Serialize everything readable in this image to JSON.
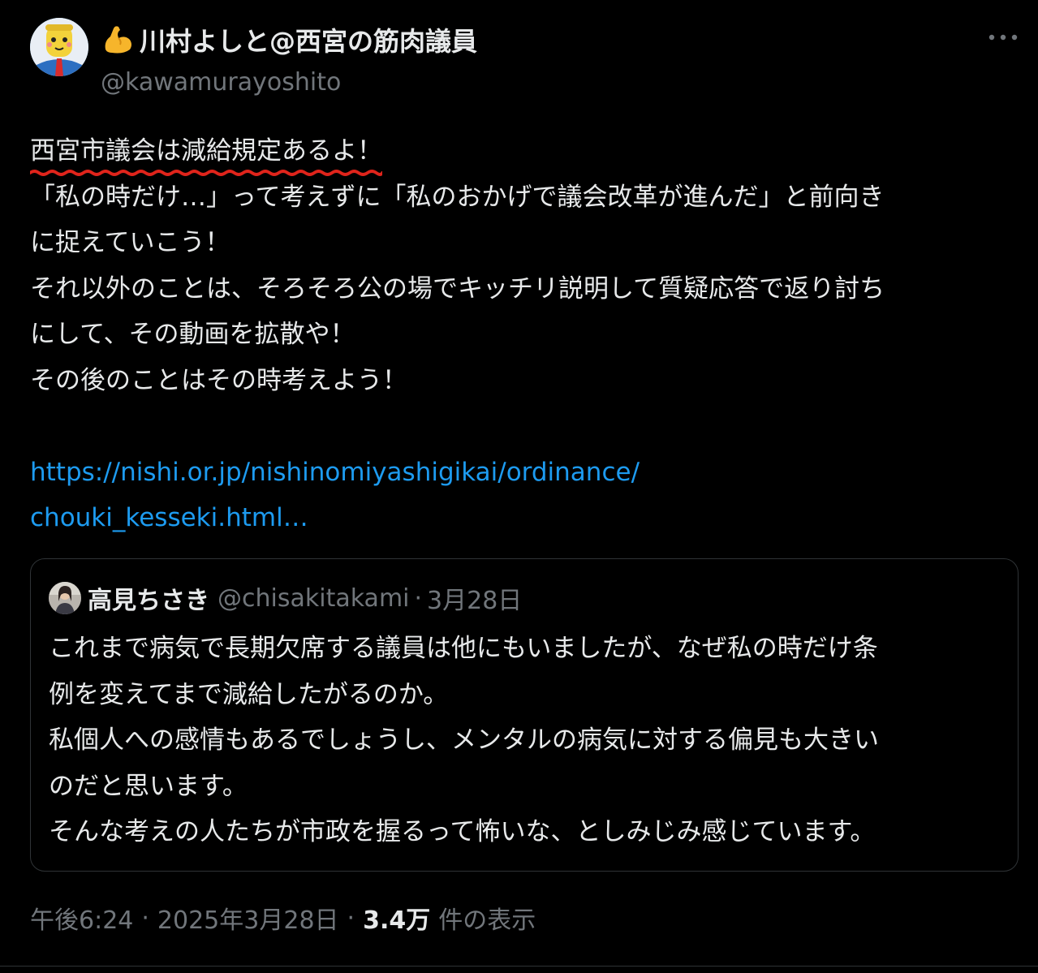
{
  "author": {
    "display_name": "川村よしと@西宮の筋肉議員",
    "handle": "@kawamurayoshito",
    "avatar_icon": "cartoon-mascot-avatar",
    "name_prefix_icon": "flexed-biceps-icon"
  },
  "more_icon": "more-horizontal-icon",
  "tweet": {
    "highlighted": "西宮市議会は減給規定あるよ！",
    "lines": [
      "「私の時だけ…」って考えずに「私のおかげで議会改革が進んだ」と前向き",
      "に捉えていこう！",
      "それ以外のことは、そろそろ公の場でキッチリ説明して質疑応答で返り討ち",
      "にして、その動画を拡散や！",
      "その後のことはその時考えよう！"
    ],
    "link_line1": "https://nishi.or.jp/nishinomiyashigikai/ordinance/",
    "link_line2": "chouki_kesseki.html…"
  },
  "quote": {
    "name": "高見ちさき",
    "handle": "@chisakitakami",
    "dot": "·",
    "date": "3月28日",
    "lines": [
      "これまで病気で長期欠席する議員は他にもいましたが、なぜ私の時だけ条",
      "例を変えてまで減給したがるのか。",
      "私個人への感情もあるでしょうし、メンタルの病気に対する偏見も大きい",
      "のだと思います。",
      "そんな考えの人たちが市政を握るって怖いな、としみじみ感じています。"
    ]
  },
  "meta": {
    "time": "午後6:24",
    "sep1": "·",
    "date": "2025年3月28日",
    "sep2": "·",
    "views_count": "3.4万",
    "views_label": "件の表示"
  },
  "colors": {
    "background": "#000000",
    "text": "#e7e9ea",
    "muted": "#71767b",
    "link": "#1d9bf0",
    "border": "#2f3336",
    "annotation_red": "#e0241b"
  }
}
